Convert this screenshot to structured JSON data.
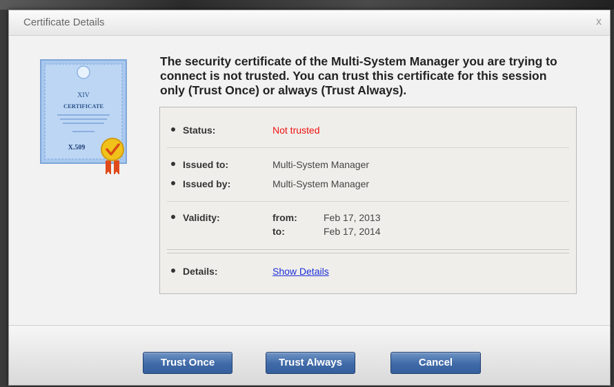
{
  "dialog": {
    "title": "Certificate Details",
    "close_glyph": "x",
    "message": "The security certificate of the Multi-System Manager you are trying to connect is not trusted. You can trust this certificate for this session only (Trust Once) or always (Trust Always)."
  },
  "certificate_icon": {
    "icon": "certificate-icon",
    "text_roman": "XIV",
    "text_heading": "CERTIFICATE",
    "text_type": "X.509"
  },
  "details": {
    "status_label": "Status:",
    "status_value": "Not trusted",
    "issued_to_label": "Issued to:",
    "issued_to_value": "Multi-System Manager",
    "issued_by_label": "Issued by:",
    "issued_by_value": "Multi-System Manager",
    "validity_label": "Validity:",
    "from_label": "from:",
    "from_value": "Feb 17, 2013",
    "to_label": "to:",
    "to_value": "Feb 17, 2014",
    "details_label": "Details:",
    "details_link": "Show Details"
  },
  "buttons": {
    "trust_once": "Trust Once",
    "trust_always": "Trust Always",
    "cancel": "Cancel"
  },
  "colors": {
    "status_text": "#e11111",
    "link": "#1b2fd8",
    "button": "#3f6aa8"
  }
}
